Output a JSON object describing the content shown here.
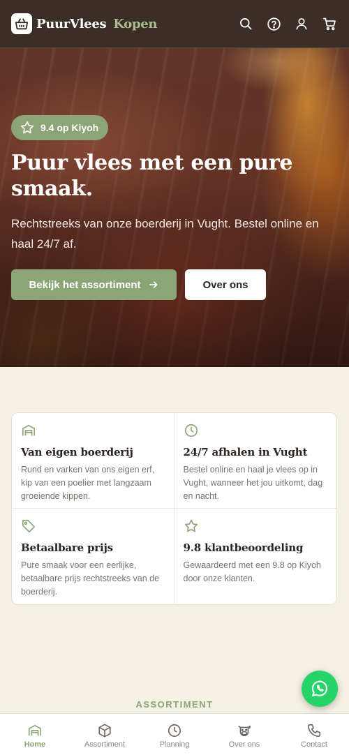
{
  "header": {
    "brand_main": "PuurVlees",
    "brand_accent": "Kopen",
    "icons": [
      "search-icon",
      "help-icon",
      "user-icon",
      "cart-icon"
    ]
  },
  "hero": {
    "badge": "9.4 op Kiyoh",
    "title": "Puur vlees met een pure smaak.",
    "subtitle": "Rechtstreeks van onze boerderij in Vught. Bestel online en haal 24/7 af.",
    "primary_button": "Bekijk het assortiment",
    "secondary_button": "Over ons"
  },
  "features": [
    {
      "icon": "barn-icon",
      "title": "Van eigen boerderij",
      "text": "Rund en varken van ons eigen erf, kip van een poelier met langzaam groeiende kippen."
    },
    {
      "icon": "clock-icon",
      "title": "24/7 afhalen in Vught",
      "text": "Bestel online en haal je vlees op in Vught, wanneer het jou uitkomt, dag en nacht."
    },
    {
      "icon": "tag-icon",
      "title": "Betaalbare prijs",
      "text": "Pure smaak voor een eerlijke, betaalbare prijs rechtstreeks van de boerderij."
    },
    {
      "icon": "star-icon",
      "title": "9.8 klantbeoordeling",
      "text": "Gewaardeerd met een 9.8 op Kiyoh door onze klanten."
    }
  ],
  "section_label": "ASSORTIMENT",
  "bottom_nav": [
    {
      "label": "Home",
      "icon": "home-icon",
      "active": true
    },
    {
      "label": "Assortiment",
      "icon": "box-icon",
      "active": false
    },
    {
      "label": "Planning",
      "icon": "clock-icon",
      "active": false
    },
    {
      "label": "Over ons",
      "icon": "cow-icon",
      "active": false
    },
    {
      "label": "Contact",
      "icon": "phone-icon",
      "active": false
    }
  ],
  "colors": {
    "header_bg": "#3a2e27",
    "accent_green": "#8ca577",
    "page_bg": "#f5f0e4",
    "whatsapp": "#25d366"
  }
}
